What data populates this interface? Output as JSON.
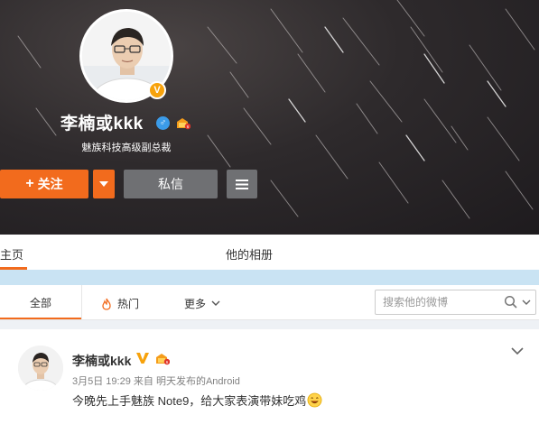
{
  "profile": {
    "name": "李楠或kkk",
    "verified_badge": "V",
    "gender_icon": "male-icon",
    "bio": "魅族科技高级副总裁",
    "follow_label": "关注",
    "follow_plus": "+",
    "message_label": "私信"
  },
  "tabs": {
    "home": "主页",
    "album": "他的相册"
  },
  "filters": {
    "all": "全部",
    "hot": "热门",
    "more": "更多",
    "search_placeholder": "搜索他的微博"
  },
  "post": {
    "name": "李楠或kkk",
    "time": "3月5日 19:29",
    "source_prefix": "来自",
    "source": "明天发布的Android",
    "text": "今晚先上手魅族 Note9，给大家表演带妹吃鸡"
  },
  "colors": {
    "accent": "#f26b1d",
    "verified": "#f7a20b",
    "button_gray": "#6f7073"
  }
}
